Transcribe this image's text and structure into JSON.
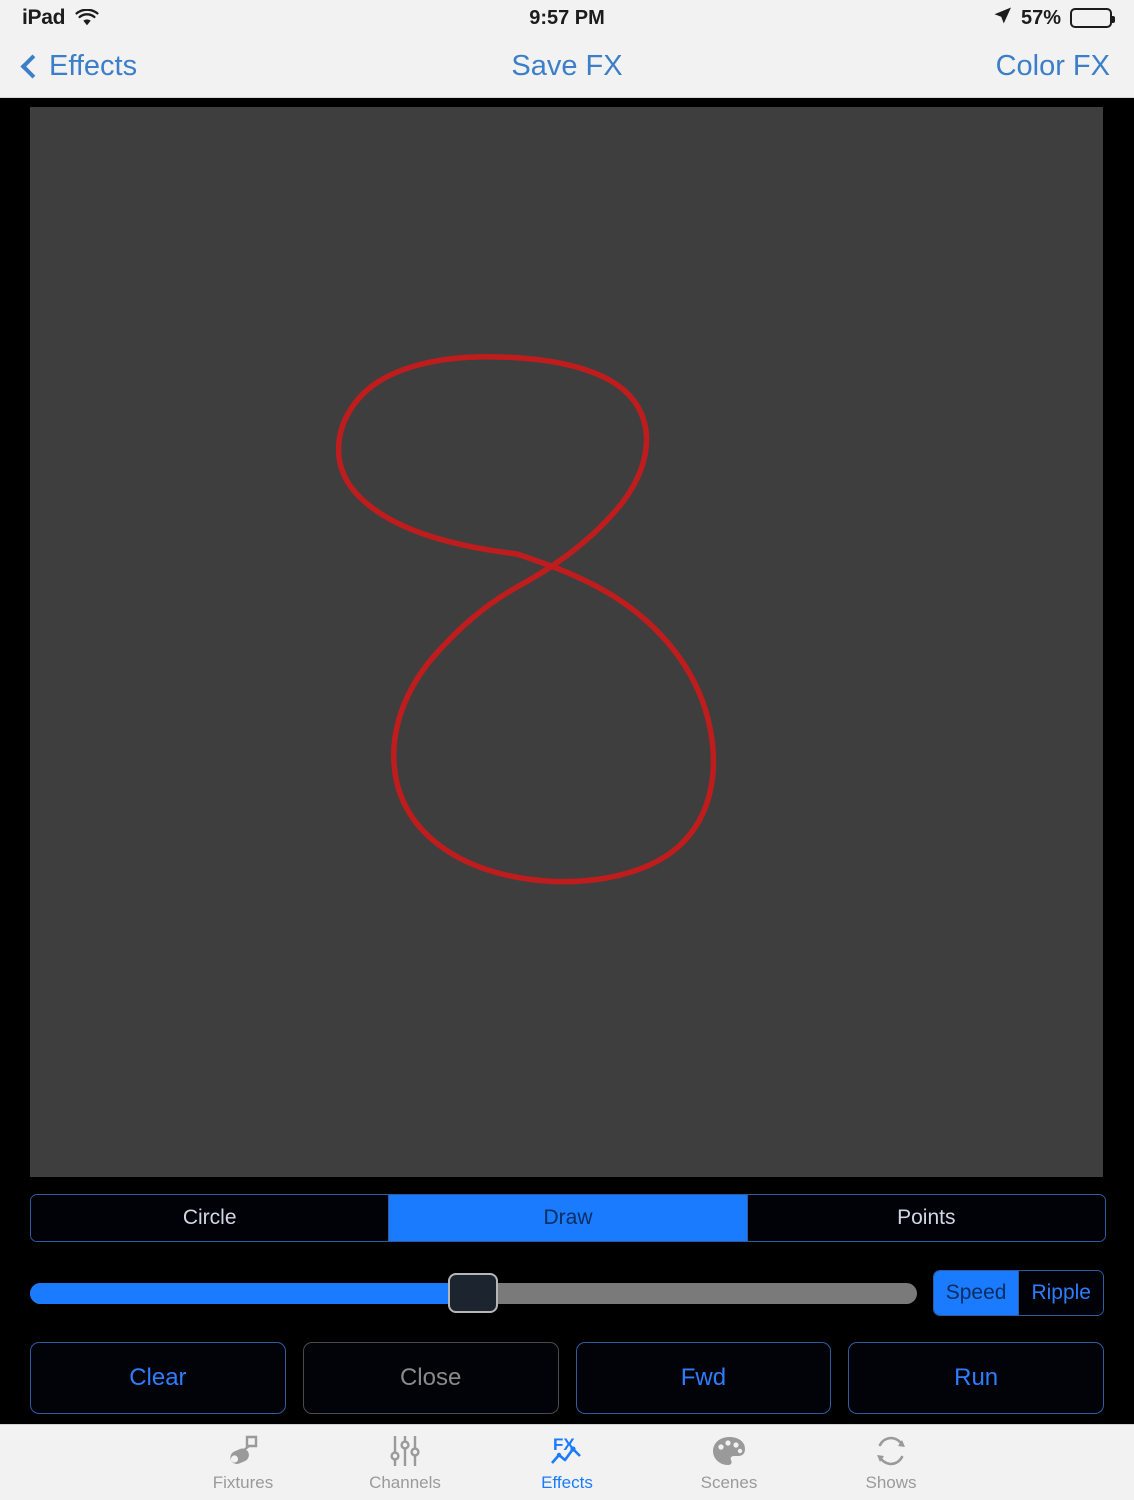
{
  "status_bar": {
    "device": "iPad",
    "wifi_icon": "wifi-icon",
    "time": "9:57 PM",
    "location_icon": "location-arrow-icon",
    "battery_percent": "57%",
    "battery_level": 57,
    "battery_icon": "battery-icon"
  },
  "nav_bar": {
    "back_icon": "chevron-left-icon",
    "back_label": "Effects",
    "title": "Save FX",
    "right_action": "Color FX",
    "tint_color": "#3c7fc8"
  },
  "canvas": {
    "name": "fx-draw-canvas",
    "background": "#3e3e3e",
    "stroke_color": "#bf1d1d",
    "stroke_width": 5,
    "shape": "figure-eight-freehand-path"
  },
  "shape_modes": {
    "options": [
      "Circle",
      "Draw",
      "Points"
    ],
    "selected": "Draw",
    "selected_bg": "#1a7bff"
  },
  "slider": {
    "name": "speed-slider",
    "value_percent": 50,
    "fill_color": "#1a7bff",
    "track_color": "#7a7a7a"
  },
  "mode_toggle": {
    "options": [
      "Speed",
      "Ripple"
    ],
    "selected": "Speed"
  },
  "actions": [
    {
      "label": "Clear",
      "enabled": true
    },
    {
      "label": "Close",
      "enabled": false
    },
    {
      "label": "Fwd",
      "enabled": true
    },
    {
      "label": "Run",
      "enabled": true
    }
  ],
  "tabs": [
    {
      "label": "Fixtures",
      "icon": "stage-light-icon",
      "active": false
    },
    {
      "label": "Channels",
      "icon": "faders-icon",
      "active": false
    },
    {
      "label": "Effects",
      "icon": "fx-icon",
      "active": true
    },
    {
      "label": "Scenes",
      "icon": "palette-icon",
      "active": false
    },
    {
      "label": "Shows",
      "icon": "refresh-circle-icon",
      "active": false
    }
  ]
}
